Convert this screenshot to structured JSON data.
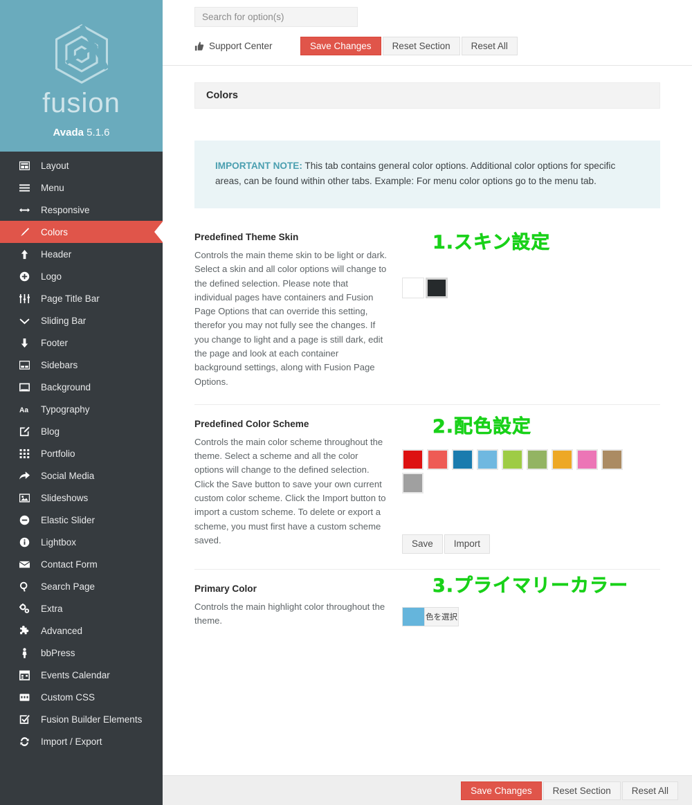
{
  "brand": {
    "logo_icon": "fusion-hexagon-logo",
    "wordmark": "fusion",
    "product": "Avada",
    "version": "5.1.6"
  },
  "sidebar": {
    "items": [
      {
        "label": "Layout",
        "icon": "layout-icon",
        "active": false
      },
      {
        "label": "Menu",
        "icon": "menu-bars-icon",
        "active": false
      },
      {
        "label": "Responsive",
        "icon": "arrows-horizontal-icon",
        "active": false
      },
      {
        "label": "Colors",
        "icon": "brush-icon",
        "active": true
      },
      {
        "label": "Header",
        "icon": "arrow-up-icon",
        "active": false
      },
      {
        "label": "Logo",
        "icon": "plus-circle-icon",
        "active": false
      },
      {
        "label": "Page Title Bar",
        "icon": "sliders-icon",
        "active": false
      },
      {
        "label": "Sliding Bar",
        "icon": "chevron-down-icon",
        "active": false
      },
      {
        "label": "Footer",
        "icon": "arrow-down-icon",
        "active": false
      },
      {
        "label": "Sidebars",
        "icon": "sidebar-icon",
        "active": false
      },
      {
        "label": "Background",
        "icon": "window-icon",
        "active": false
      },
      {
        "label": "Typography",
        "icon": "text-aa-icon",
        "active": false
      },
      {
        "label": "Blog",
        "icon": "pencil-square-icon",
        "active": false
      },
      {
        "label": "Portfolio",
        "icon": "grid-dots-icon",
        "active": false
      },
      {
        "label": "Social Media",
        "icon": "share-arrow-icon",
        "active": false
      },
      {
        "label": "Slideshows",
        "icon": "image-icon",
        "active": false
      },
      {
        "label": "Elastic Slider",
        "icon": "minus-circle-icon",
        "active": false
      },
      {
        "label": "Lightbox",
        "icon": "info-circle-icon",
        "active": false
      },
      {
        "label": "Contact Form",
        "icon": "envelope-icon",
        "active": false
      },
      {
        "label": "Search Page",
        "icon": "search-icon",
        "active": false
      },
      {
        "label": "Extra",
        "icon": "gears-icon",
        "active": false
      },
      {
        "label": "Advanced",
        "icon": "puzzle-icon",
        "active": false
      },
      {
        "label": "bbPress",
        "icon": "person-icon",
        "active": false
      },
      {
        "label": "Events Calendar",
        "icon": "calendar-icon",
        "active": false
      },
      {
        "label": "Custom CSS",
        "icon": "code-icon",
        "active": false
      },
      {
        "label": "Fusion Builder Elements",
        "icon": "check-square-icon",
        "active": false
      },
      {
        "label": "Import / Export",
        "icon": "refresh-icon",
        "active": false
      }
    ]
  },
  "topbar": {
    "search_placeholder": "Search for option(s)",
    "search_value": "",
    "support_label": "Support Center",
    "support_icon": "thumbs-up-icon",
    "save_label": "Save Changes",
    "reset_section_label": "Reset Section",
    "reset_all_label": "Reset All"
  },
  "panel": {
    "title": "Colors",
    "notice_strong": "IMPORTANT NOTE:",
    "notice_text": " This tab contains general color options. Additional color options for specific areas, can be found within other tabs. Example: For menu color options go to the menu tab."
  },
  "options": {
    "theme_skin": {
      "title": "Predefined Theme Skin",
      "desc": "Controls the main theme skin to be light or dark. Select a skin and all color options will change to the defined selection. Please note that individual pages have containers and Fusion Page Options that can override this setting, therefor you may not fully see the changes. If you change to light and a page is still dark, edit the page and look at each container background settings, along with Fusion Page Options.",
      "annotation": "1.スキン設定",
      "skins": [
        {
          "name": "light",
          "color": "#ffffff",
          "selected": false
        },
        {
          "name": "dark",
          "color": "#262a2c",
          "selected": true
        }
      ]
    },
    "color_scheme": {
      "title": "Predefined Color Scheme",
      "desc": "Controls the main color scheme throughout the theme. Select a scheme and all the color options will change to the defined selection. Click the Save button to save your own current custom color scheme. Click the Import button to import a custom scheme. To delete or export a scheme, you must first have a custom scheme saved.",
      "annotation": "2.配色設定",
      "swatches": [
        {
          "name": "red",
          "color": "#dd1111"
        },
        {
          "name": "salmon",
          "color": "#ee5b55"
        },
        {
          "name": "blue",
          "color": "#1a7bae"
        },
        {
          "name": "light-blue",
          "color": "#6fb8e0"
        },
        {
          "name": "lime",
          "color": "#9ecc45"
        },
        {
          "name": "olive",
          "color": "#93b463"
        },
        {
          "name": "orange",
          "color": "#eda825"
        },
        {
          "name": "pink",
          "color": "#ec75b6"
        },
        {
          "name": "brown",
          "color": "#ab8b63"
        },
        {
          "name": "gray",
          "color": "#a0a0a0"
        }
      ],
      "save_label": "Save",
      "import_label": "Import"
    },
    "primary_color": {
      "title": "Primary Color",
      "desc": "Controls the main highlight color throughout the theme.",
      "annotation": "3.プライマリーカラー",
      "swatch_color": "#65b5dc",
      "picker_label": "色を選択"
    }
  },
  "footer": {
    "save_label": "Save Changes",
    "reset_section_label": "Reset Section",
    "reset_all_label": "Reset All"
  },
  "colors": {
    "brand_bg": "#6aabbd",
    "sidebar_bg": "#363b3f",
    "accent": "#e0554a",
    "annotation_green": "#19d119",
    "notice_bg": "#eaf4f6",
    "notice_accent": "#4b9fb0"
  }
}
